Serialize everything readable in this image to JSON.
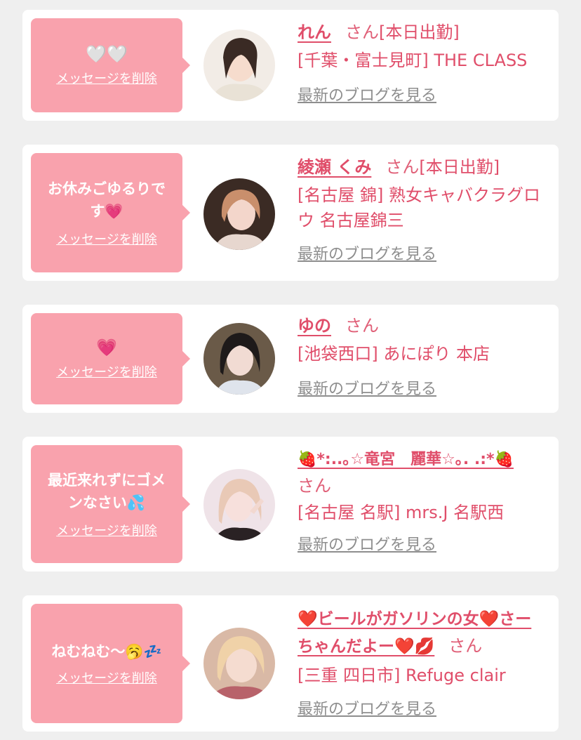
{
  "common": {
    "delete_label": "メッセージを削除",
    "san": "さん",
    "blog_link": "最新のブログを見る"
  },
  "items": [
    {
      "message": "🤍🤍",
      "name": "れん",
      "status": "[本日出勤]",
      "shop": "[千葉・富士見町] THE CLASS"
    },
    {
      "message": "お休みごゆるりです💗",
      "name": "綾瀬 くみ",
      "status": "[本日出勤]",
      "shop": "[名古屋 錦] 熟女キャバクラグロウ 名古屋錦三"
    },
    {
      "message": "💗",
      "name": "ゆの",
      "status": "",
      "shop": "[池袋西口] あにぽり 本店"
    },
    {
      "message": "最近来れずにゴメンなさい💦",
      "name": "🍓*:..｡☆竜宮　麗華☆｡. .:*🍓",
      "status": "",
      "shop": "[名古屋 名駅] mrs.J 名駅西"
    },
    {
      "message": "ねむねむ〜🥱💤",
      "name": "❤️ビールがガソリンの女❤️さーちゃんだよー❤️💋",
      "status": "",
      "shop": "[三重 四日市] Refuge clair"
    }
  ],
  "colors": {
    "accent": "#e04e6a",
    "bubble": "#f9a2ad",
    "link_gray": "#8e8e8e",
    "background": "#efefef"
  }
}
